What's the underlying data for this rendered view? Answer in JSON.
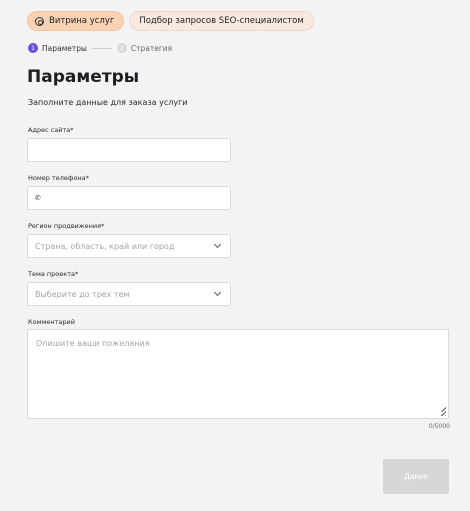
{
  "tabs": [
    {
      "label": "Витрина услуг",
      "icon": "services-icon",
      "active": true
    },
    {
      "label": "Подбор запросов SEO-специалистом",
      "active": false
    }
  ],
  "steps": [
    {
      "num": "1",
      "label": "Параметры",
      "active": true
    },
    {
      "num": "2",
      "label": "Стратегия",
      "active": false
    }
  ],
  "page": {
    "title": "Параметры",
    "subtitle": "Заполните данные для заказа услуги"
  },
  "form": {
    "site": {
      "label": "Адрес сайта*",
      "value": ""
    },
    "phone": {
      "label": "Номер телефона*",
      "value": "",
      "icon": "phone-icon"
    },
    "region": {
      "label": "Регион продвижения*",
      "placeholder": "Страна, область, край или город"
    },
    "topic": {
      "label": "Тема проекта*",
      "placeholder": "Выберите до трех тем"
    },
    "comment": {
      "label": "Комментарий",
      "placeholder": "Опишите ваши пожелания",
      "counter": "0/5000"
    }
  },
  "actions": {
    "next_label": "Далее"
  },
  "colors": {
    "accent": "#6c4de6",
    "chip_active": "#f9d2b3",
    "button_disabled": "#d6d6d9"
  }
}
